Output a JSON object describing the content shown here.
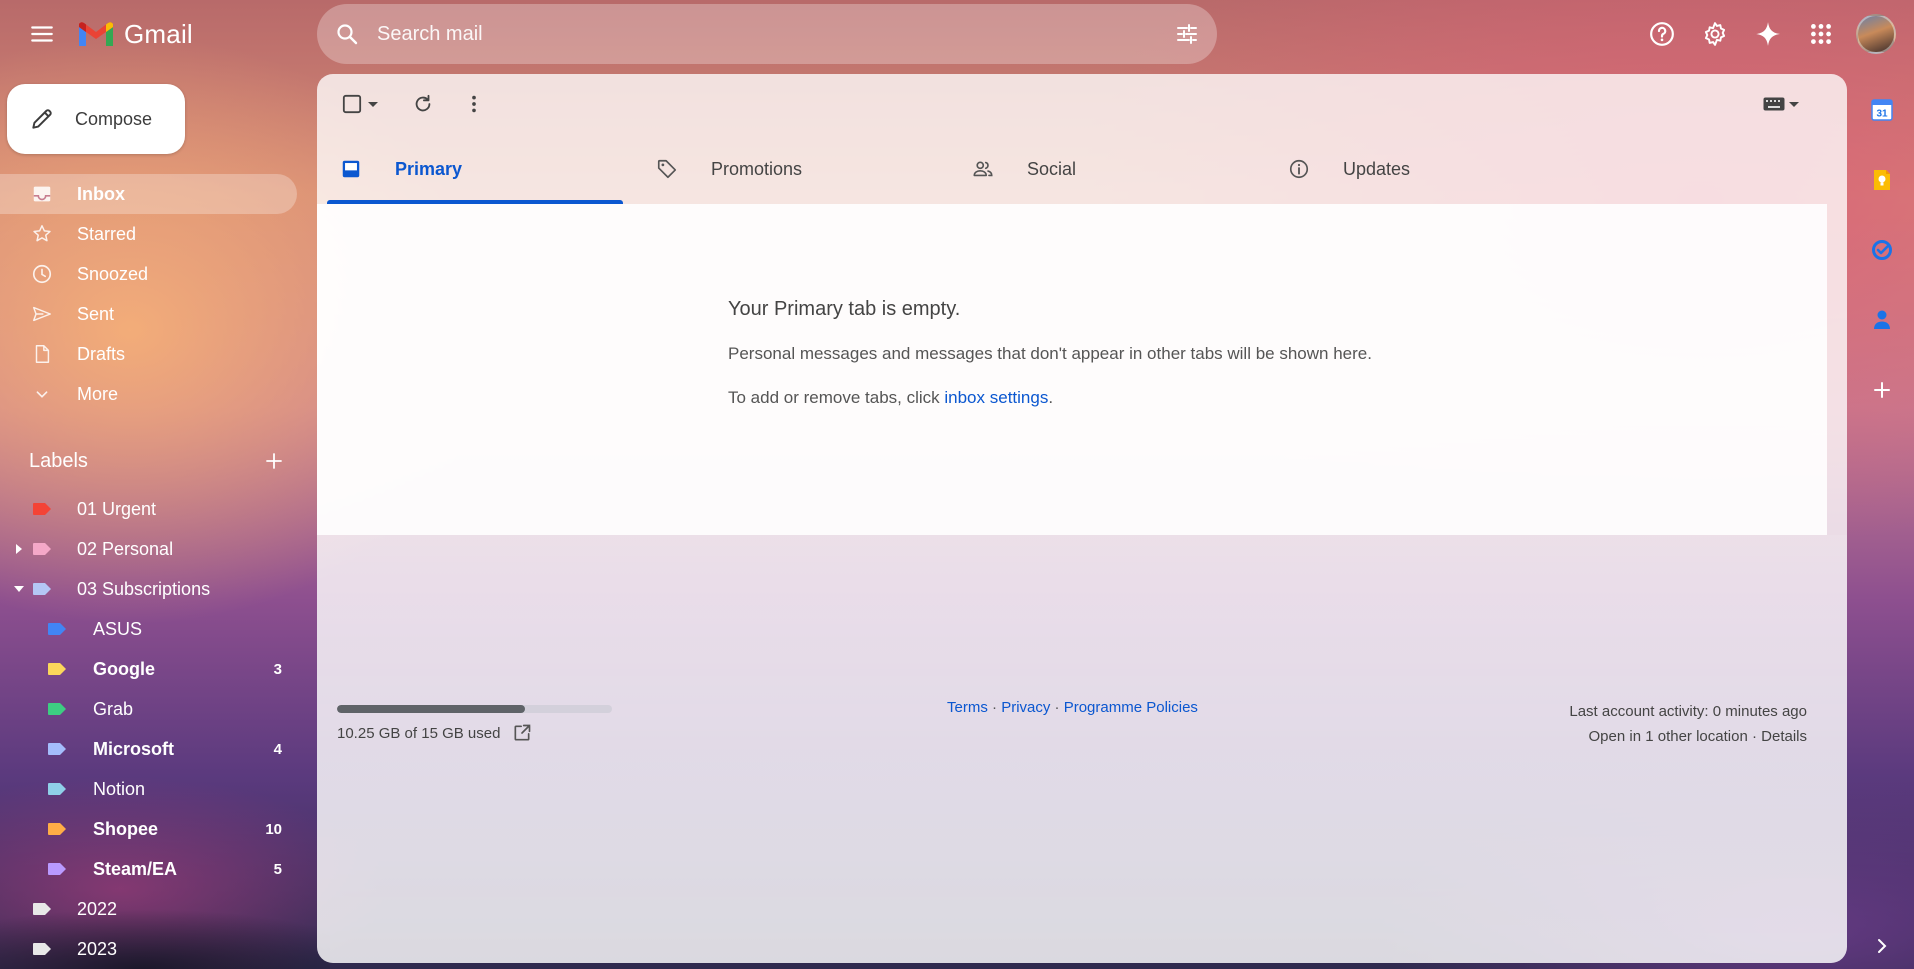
{
  "app": {
    "name": "Gmail"
  },
  "search": {
    "placeholder": "Search mail"
  },
  "compose": {
    "label": "Compose"
  },
  "nav": {
    "items": [
      {
        "label": "Inbox",
        "icon": "inbox-icon",
        "active": true
      },
      {
        "label": "Starred",
        "icon": "star-icon"
      },
      {
        "label": "Snoozed",
        "icon": "clock-icon"
      },
      {
        "label": "Sent",
        "icon": "send-icon"
      },
      {
        "label": "Drafts",
        "icon": "draft-icon"
      },
      {
        "label": "More",
        "icon": "chevron-down-icon"
      }
    ]
  },
  "labels": {
    "title": "Labels",
    "items": [
      {
        "name": "01 Urgent",
        "color": "#f44336"
      },
      {
        "name": "02 Personal",
        "color": "#f4a8c8"
      },
      {
        "name": "03 Subscriptions",
        "color": "#b4c7f5"
      },
      {
        "name": "ASUS",
        "color": "#4285f4",
        "count": ""
      },
      {
        "name": "Google",
        "color": "#fbd75b",
        "count": "3"
      },
      {
        "name": "Grab",
        "color": "#3dcd82",
        "count": ""
      },
      {
        "name": "Microsoft",
        "color": "#a4bdfc",
        "count": "4"
      },
      {
        "name": "Notion",
        "color": "#8fd0e8",
        "count": ""
      },
      {
        "name": "Shopee",
        "color": "#ffad46",
        "count": "10"
      },
      {
        "name": "Steam/EA",
        "color": "#b99aff",
        "count": "5"
      },
      {
        "name": "2022",
        "color": "#e8e8e8"
      },
      {
        "name": "2023",
        "color": "#e8e8e8"
      }
    ]
  },
  "tabs": [
    {
      "label": "Primary",
      "icon": "inbox-tab-icon",
      "active": true
    },
    {
      "label": "Promotions",
      "icon": "tag-icon"
    },
    {
      "label": "Social",
      "icon": "people-icon"
    },
    {
      "label": "Updates",
      "icon": "info-icon"
    }
  ],
  "empty": {
    "title": "Your Primary tab is empty.",
    "line1": "Personal messages and messages that don't appear in other tabs will be shown here.",
    "line2_prefix": "To add or remove tabs, click ",
    "line2_link": "inbox settings",
    "line2_suffix": "."
  },
  "storage": {
    "text": "10.25 GB of 15 GB used",
    "used_fraction": 0.683
  },
  "footer": {
    "terms": "Terms",
    "privacy": "Privacy",
    "policies": "Programme Policies",
    "sep": " · ",
    "activity": "Last account activity: 0 minutes ago",
    "location": "Open in 1 other location",
    "details": "Details"
  },
  "colors": {
    "accent": "#0b57d0",
    "calendar": "#4285f4",
    "keep": "#fbbc04",
    "tasks": "#1a73e8",
    "contacts": "#1a73e8"
  },
  "side_panel": [
    "calendar-icon",
    "keep-icon",
    "tasks-icon",
    "contacts-icon",
    "add-addon-icon"
  ],
  "calendar_day": "31"
}
